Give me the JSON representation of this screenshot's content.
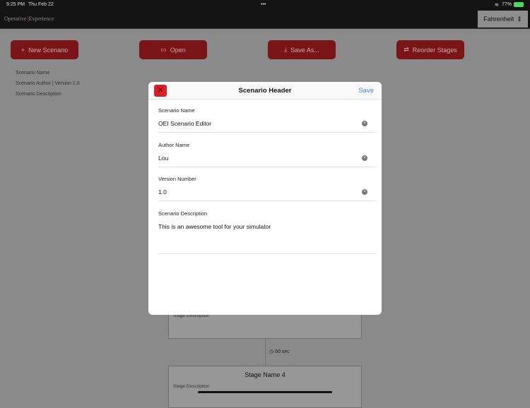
{
  "status": {
    "time": "9:25 PM",
    "date": "Thu Feb 22",
    "dots": "•••",
    "battery": "77%"
  },
  "header": {
    "logo_left": "Operative",
    "logo_right": "Experience",
    "unit": "Fahrenheit"
  },
  "toolbar": {
    "new": "New Scenario",
    "open": "Open",
    "save_as": "Save As...",
    "reorder": "Reorder Stages"
  },
  "scenario": {
    "name": "Scenario Name",
    "author_version": "Scenario Author | Version 1.0",
    "description": "Scenario Description"
  },
  "stages": [
    {
      "description": "Stage Description"
    },
    {
      "name": "Stage Name 4",
      "description": "Stage Description"
    }
  ],
  "timer": "60 sec",
  "modal": {
    "title": "Scenario Header",
    "save": "Save",
    "fields": [
      {
        "label": "Scenario Name",
        "value": "OEI Scenario Editor"
      },
      {
        "label": "Author Name",
        "value": "Lou"
      },
      {
        "label": "Version Number",
        "value": "1.0"
      },
      {
        "label": "Scenario Description",
        "value": "This is an awesome tool for your simulator"
      }
    ]
  }
}
